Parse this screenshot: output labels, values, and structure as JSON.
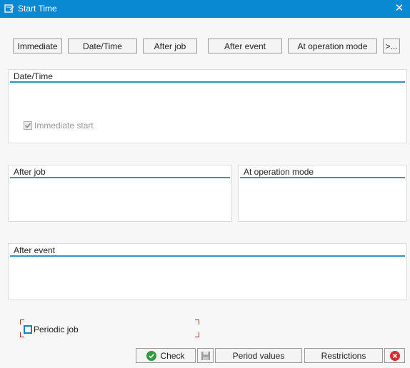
{
  "window": {
    "title": "Start Time",
    "close_glyph": "✕",
    "title_icon": "window-icon"
  },
  "toolbar": {
    "immediate": "Immediate",
    "date_time": "Date/Time",
    "after_job": "After job",
    "after_event": "After event",
    "at_operation_mode": "At operation mode",
    "more": ">..."
  },
  "groups": {
    "date_time": {
      "title": "Date/Time",
      "immediate_start": {
        "label": "Immediate start",
        "checked": true,
        "disabled": true
      }
    },
    "after_job": {
      "title": "After job"
    },
    "at_operation_mode": {
      "title": "At operation mode"
    },
    "after_event": {
      "title": "After event"
    }
  },
  "periodic_job": {
    "label": "Periodic job",
    "checked": false
  },
  "footer": {
    "check": "Check",
    "period_values": "Period values",
    "restrictions": "Restrictions",
    "save_icon": "save-icon",
    "cancel_icon": "cancel-icon"
  },
  "colors": {
    "titlebar": "#0a89d3",
    "group_underline": "#2a95cf",
    "check_green": "#2a9d3c",
    "cancel_red": "#d62e2e",
    "focus_corners": "#a23030"
  }
}
